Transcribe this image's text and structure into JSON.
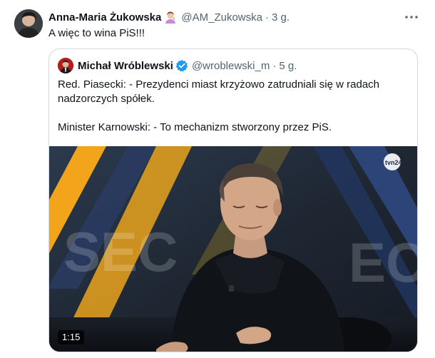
{
  "tweet": {
    "author_name": "Anna-Maria Żukowska",
    "author_emoji": "woman-gesturing-emoji",
    "handle": "@AM_Zukowska",
    "dot": "·",
    "time": "3 g.",
    "text": "A więc to wina PiS!!!"
  },
  "quote": {
    "author_name": "Michał Wróblewski",
    "verified_icon": "verified-badge-icon",
    "handle": "@wroblewski_m",
    "dot": "·",
    "time": "5 g.",
    "line1": "Red. Piasecki: - Prezydenci miast krzyżowo zatrudniali się w radach nadzorczych spółek.",
    "line2": "Minister Karnowski: - To mechanizm stworzony przez PiS.",
    "video": {
      "duration": "1:15",
      "channel_logo_text": "tvn24"
    }
  },
  "icons": {
    "more": "more-horizontal-icon"
  },
  "colors": {
    "text": "#0f1419",
    "secondary": "#536471",
    "border": "#cfd9de",
    "verified": "#1d9bf0"
  }
}
